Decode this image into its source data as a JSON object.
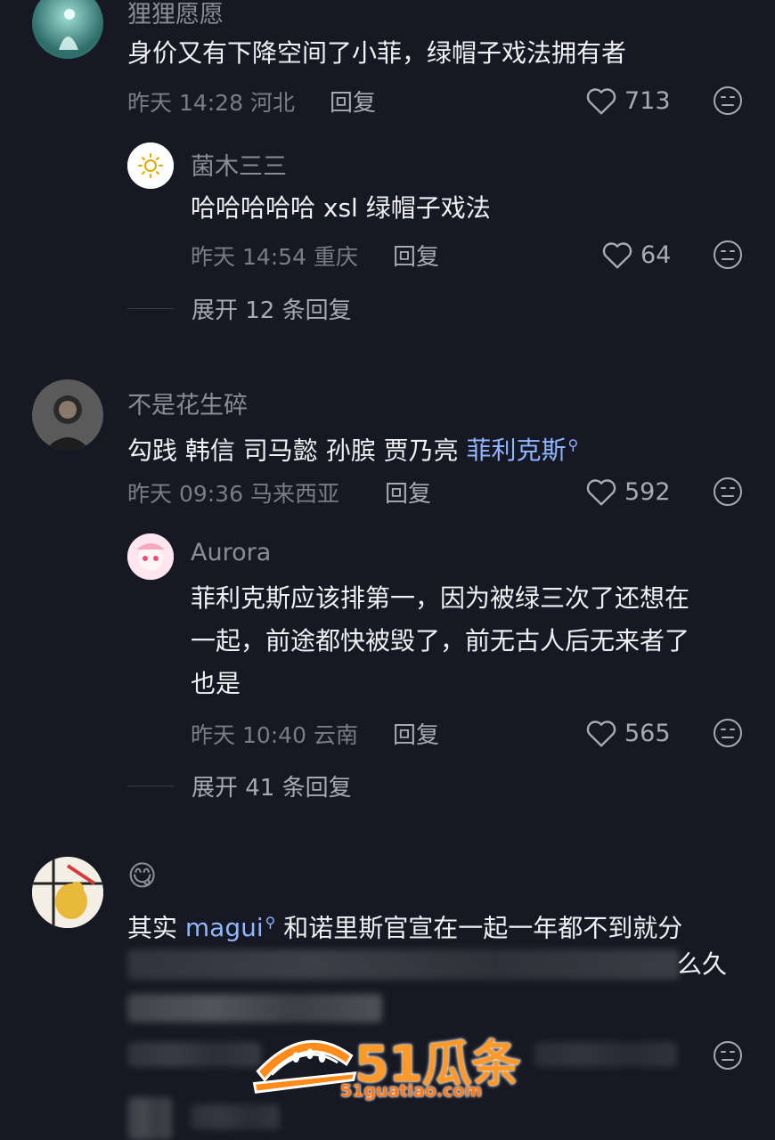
{
  "comments": [
    {
      "username": "狸狸愿愿",
      "text": "身价又有下降空间了小菲，绿帽子戏法拥有者",
      "time": "昨天 14:28",
      "location": "河北",
      "reply_label": "回复",
      "likes": "713",
      "reply": {
        "username": "菌木三三",
        "text": "哈哈哈哈哈 xsl 绿帽子戏法",
        "time": "昨天 14:54",
        "location": "重庆",
        "reply_label": "回复",
        "likes": "64"
      },
      "expand": "展开 12 条回复"
    },
    {
      "username": "不是花生碎",
      "text_parts": [
        "勾践 韩信 司马懿 孙膑 贾乃亮 ",
        "菲利克斯"
      ],
      "time": "昨天 09:36",
      "location": "马来西亚",
      "reply_label": "回复",
      "likes": "592",
      "reply": {
        "username": "Aurora",
        "text_lines": [
          "菲利克斯应该排第一，因为被绿三次了还想在",
          "一起，前途都快被毁了，前无古人后无来者了",
          "也是"
        ],
        "time": "昨天 10:40",
        "location": "云南",
        "reply_label": "回复",
        "likes": "565"
      },
      "expand": "展开 41 条回复"
    },
    {
      "username": "😋",
      "text_parts": [
        "其实 ",
        "magui",
        " 和诺里斯官宣在一起一年都不到就分"
      ],
      "text_line2_tail": "么久"
    }
  ],
  "watermark": {
    "brand": "51瓜条",
    "url": "51guatiao.com"
  },
  "colors": {
    "background": "#161823",
    "link": "#8fb6ff",
    "watermark": "#ff9a2a"
  }
}
